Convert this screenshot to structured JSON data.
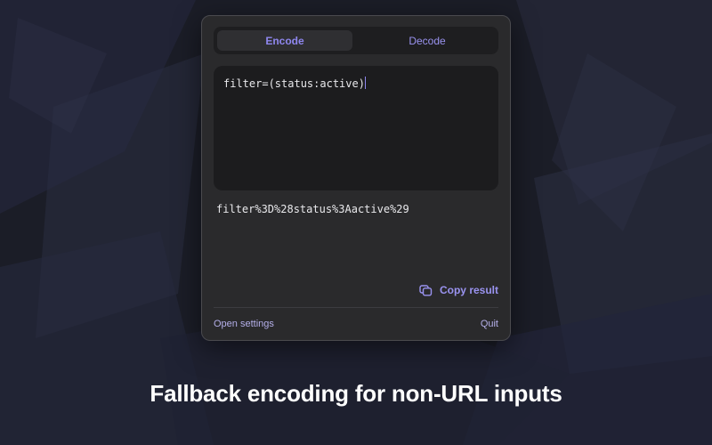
{
  "segmented": {
    "encode_label": "Encode",
    "decode_label": "Decode"
  },
  "input": {
    "value": "filter=(status:active)"
  },
  "output": {
    "value": "filter%3D%28status%3Aactive%29"
  },
  "actions": {
    "copy_label": "Copy result"
  },
  "footer": {
    "settings_label": "Open settings",
    "quit_label": "Quit"
  },
  "caption": "Fallback encoding for non-URL inputs",
  "colors": {
    "accent": "#8f87ef",
    "panel": "#2a2a2c",
    "background": "#1b1d27"
  }
}
